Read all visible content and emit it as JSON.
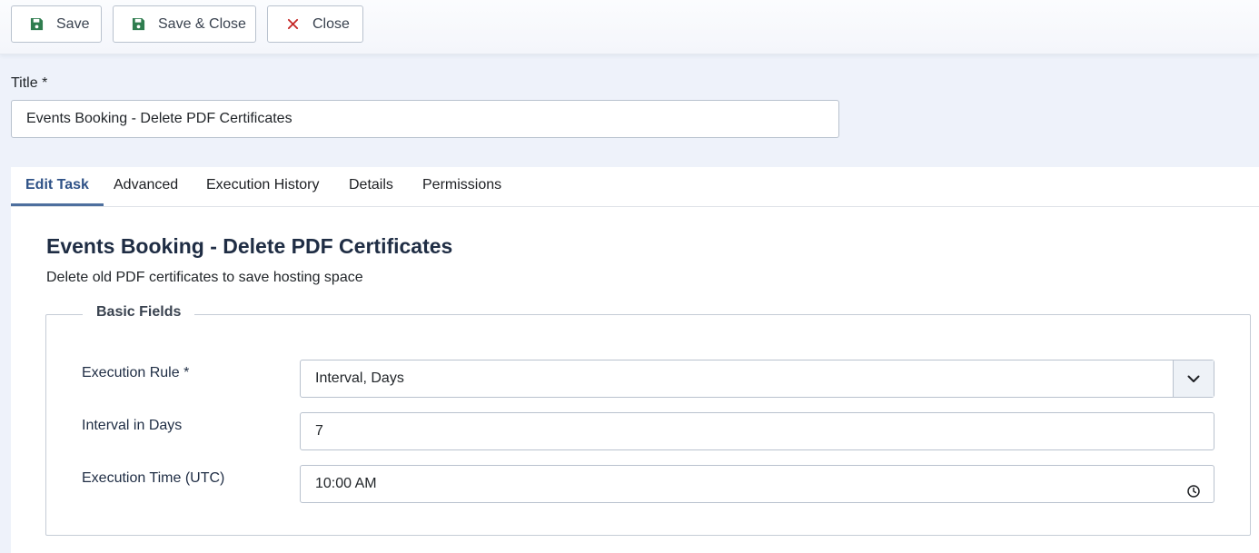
{
  "toolbar": {
    "save_label": "Save",
    "save_close_label": "Save & Close",
    "close_label": "Close",
    "save_icon": "floppy-disk-icon",
    "close_icon": "x-icon",
    "save_icon_color": "#2f7d4f",
    "close_icon_color": "#c52827"
  },
  "title_field": {
    "label": "Title *",
    "value": "Events Booking - Delete PDF Certificates"
  },
  "tabs": [
    {
      "label": "Edit Task",
      "active": true
    },
    {
      "label": "Advanced",
      "active": false
    },
    {
      "label": "Execution History",
      "active": false
    },
    {
      "label": "Details",
      "active": false
    },
    {
      "label": "Permissions",
      "active": false
    }
  ],
  "task": {
    "heading": "Events Booking - Delete PDF Certificates",
    "description": "Delete old PDF certificates to save hosting space"
  },
  "basic_fields": {
    "legend": "Basic Fields",
    "execution_rule": {
      "label": "Execution Rule *",
      "value": "Interval, Days"
    },
    "interval_days": {
      "label": "Interval in Days",
      "value": "7"
    },
    "execution_time": {
      "label": "Execution Time (UTC)",
      "value": "10:00 AM"
    }
  }
}
